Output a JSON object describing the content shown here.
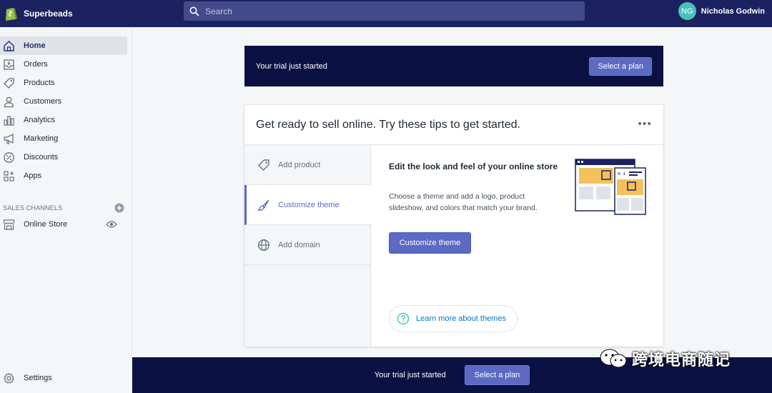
{
  "app": {
    "store_name": "Superbeads"
  },
  "search": {
    "placeholder": "Search"
  },
  "user": {
    "initials": "NG",
    "name": "Nicholas Godwin"
  },
  "sidebar": {
    "items": [
      {
        "label": "Home",
        "icon": "home-icon",
        "active": true
      },
      {
        "label": "Orders",
        "icon": "orders-icon"
      },
      {
        "label": "Products",
        "icon": "tag-icon"
      },
      {
        "label": "Customers",
        "icon": "person-icon"
      },
      {
        "label": "Analytics",
        "icon": "bar-chart-icon"
      },
      {
        "label": "Marketing",
        "icon": "megaphone-icon"
      },
      {
        "label": "Discounts",
        "icon": "discount-icon"
      },
      {
        "label": "Apps",
        "icon": "apps-icon"
      }
    ],
    "sales_channels_label": "SALES CHANNELS",
    "channels": [
      {
        "label": "Online Store",
        "icon": "store-icon"
      }
    ],
    "settings_label": "Settings"
  },
  "trial_banner": {
    "text": "Your trial just started",
    "button_label": "Select a plan"
  },
  "tips_card": {
    "title": "Get ready to sell online. Try these tips to get started.",
    "more_label": "•••",
    "tabs": [
      {
        "label": "Add product",
        "icon": "tag-icon"
      },
      {
        "label": "Customize theme",
        "icon": "brush-icon",
        "active": true
      },
      {
        "label": "Add domain",
        "icon": "globe-icon"
      }
    ],
    "active_tip": {
      "title": "Edit the look and feel of your online store",
      "description": "Choose a theme and add a logo, product slideshow, and colors that match your brand.",
      "button_label": "Customize theme",
      "learn_more_label": "Learn more about themes"
    }
  },
  "bottom_bar": {
    "text": "Your trial just started",
    "button_label": "Select a plan"
  },
  "watermark": {
    "text": "跨境电商随记"
  },
  "colors": {
    "topbar": "#1c2260",
    "banner": "#0b1243",
    "accent": "#5c6ac4",
    "link": "#007ace"
  }
}
